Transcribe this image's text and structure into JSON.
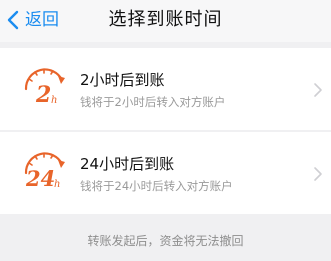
{
  "navbar": {
    "back_label": "返回",
    "title": "选择到账时间"
  },
  "options": [
    {
      "logo_text": "2",
      "logo_suffix": "h",
      "title": "2小时后到账",
      "subtitle": "钱将于2小时后转入对方账户"
    },
    {
      "logo_text": "24",
      "logo_suffix": "h",
      "title": "24小时后到账",
      "subtitle": "钱将于24小时后转入对方账户"
    }
  ],
  "footer": {
    "note": "转账发起后，资金将无法撤回"
  },
  "colors": {
    "accent": "#1a8cf0",
    "logo_orange": "#e8642a"
  }
}
